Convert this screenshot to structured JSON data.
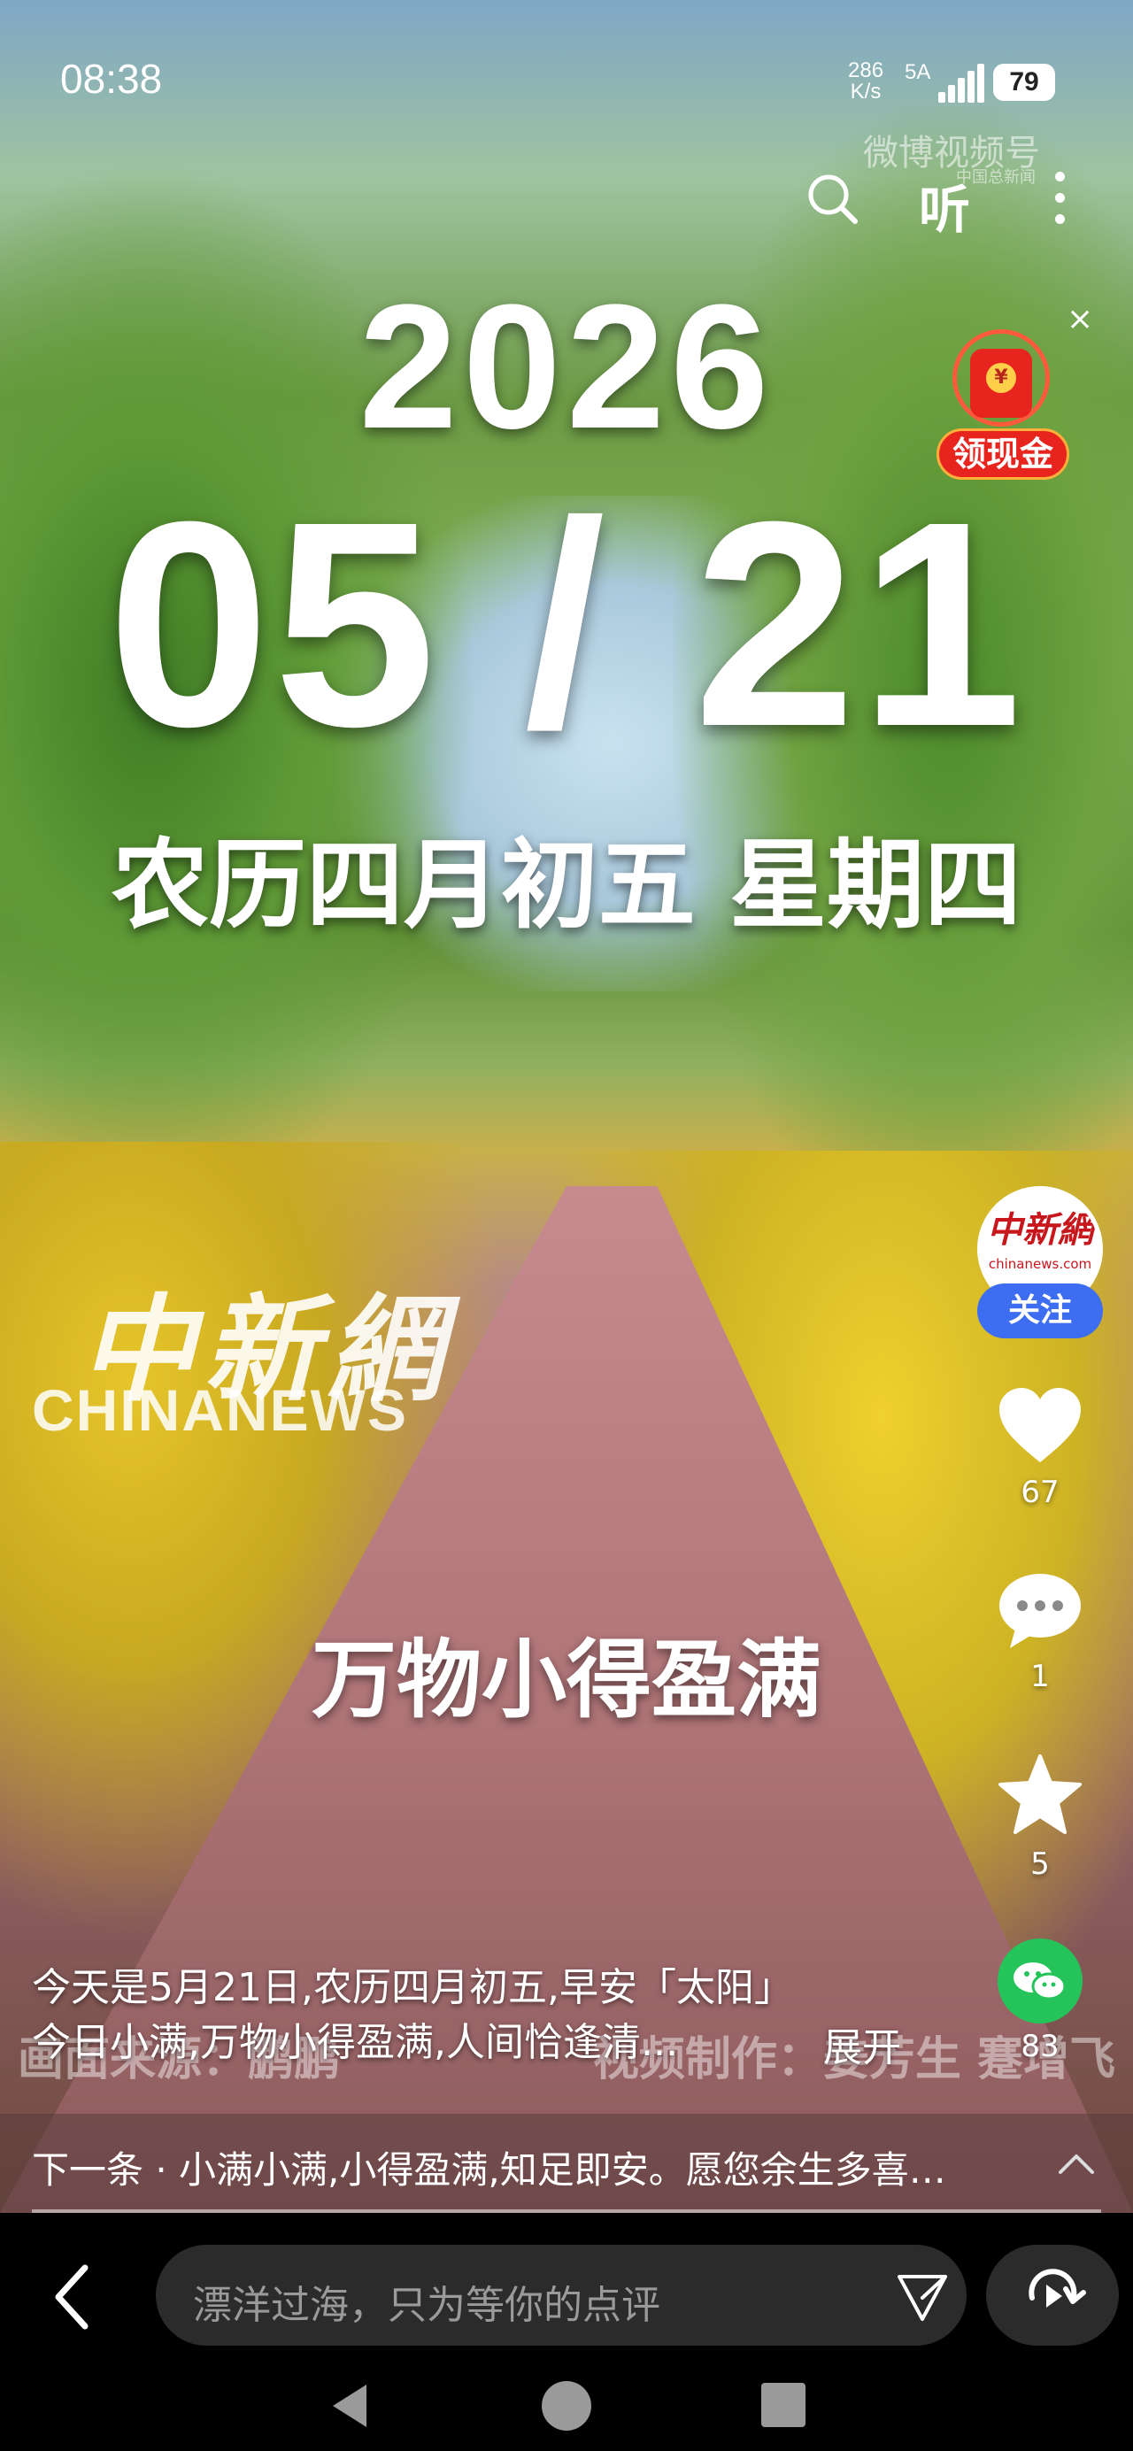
{
  "status_bar": {
    "time": "08:38",
    "net_speed": "286",
    "net_unit": "K/s",
    "network": "5A",
    "battery": "79"
  },
  "watermark": {
    "platform": "微博视频号",
    "platform_sub": "中国总新闻",
    "channel_cn": "中新網",
    "channel_en": "CHINANEWS"
  },
  "top_actions": {
    "listen_label": "听"
  },
  "promo": {
    "close": "×",
    "coin": "¥",
    "label": "领现金"
  },
  "video_text": {
    "year": "2026",
    "date": "05 / 21",
    "lunar": "农历四月初五 星期四",
    "caption": "万物小得盈满",
    "credit_left": "画面来源：鹏鹏",
    "credit_right": "视频制作：姜芳生 蹇增飞"
  },
  "account": {
    "avatar_cn": "中新網",
    "avatar_en": "chinanews.com",
    "follow_label": "关注"
  },
  "actions": {
    "likes": "67",
    "comments": "1",
    "favorites": "5",
    "shares": "83"
  },
  "description": {
    "line1": "今天是5月21日,农历四月初五,早安「太阳」",
    "line2": "今日小满,万物小得盈满,人间恰逢清...",
    "expand": "展开"
  },
  "next_bar": {
    "text": "下一条 · 小满小满,小得盈满,知足即安。愿您余生多喜…"
  },
  "comment_bar": {
    "placeholder": "漂洋过海，只为等你的点评"
  },
  "colors": {
    "follow_button": "#3d6df0",
    "redpacket": "#e8241e",
    "wechat": "#25c45a"
  }
}
